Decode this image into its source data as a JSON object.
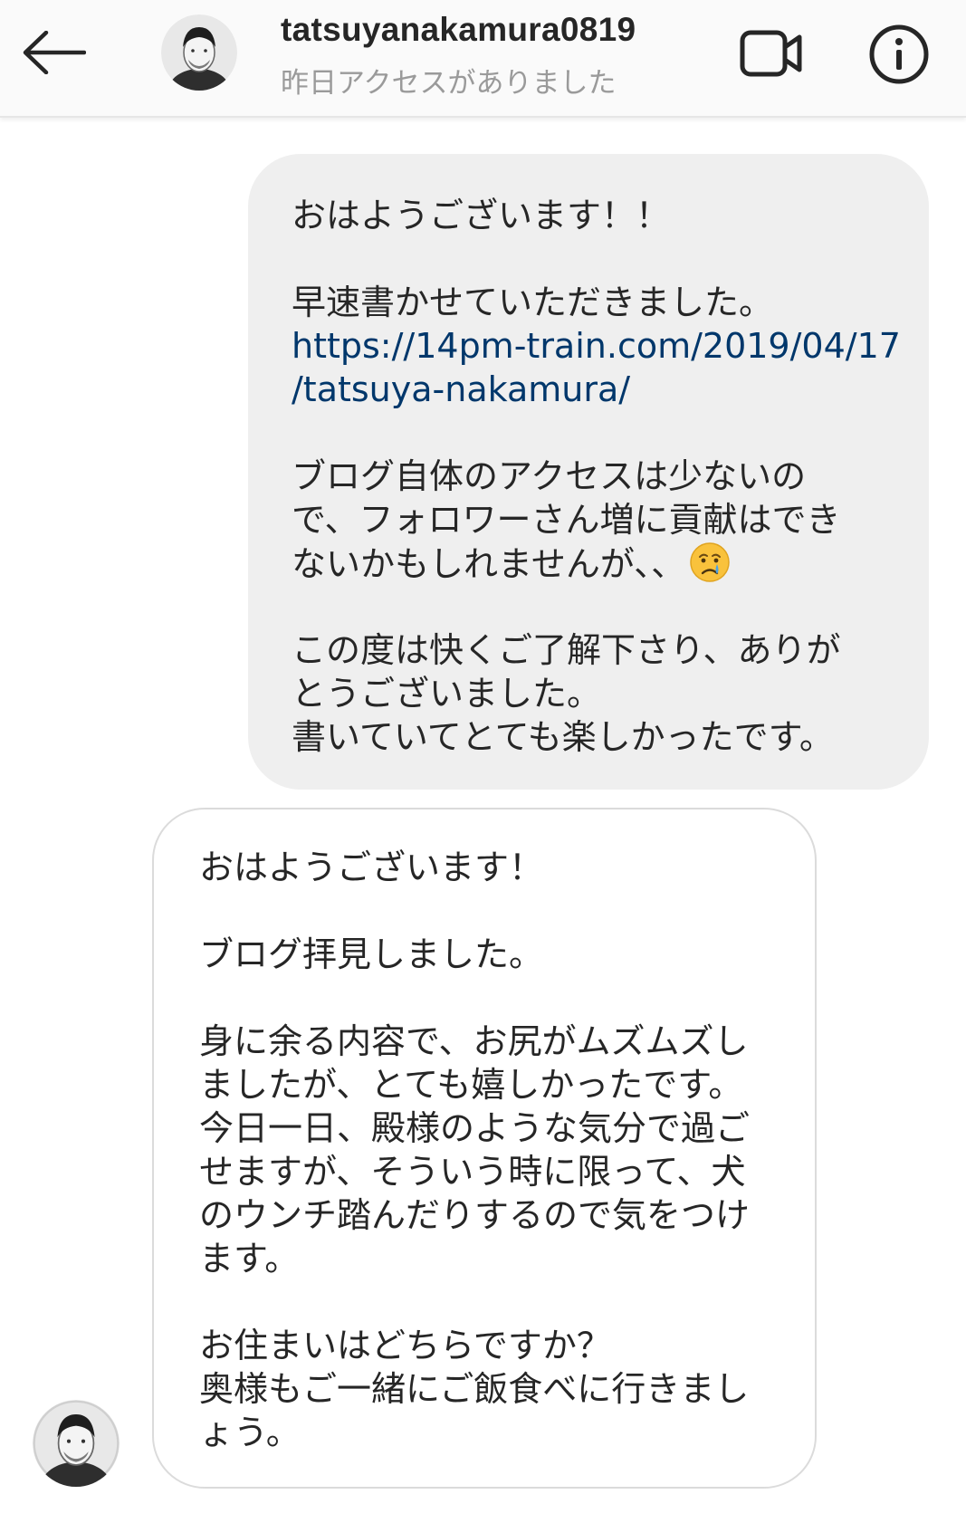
{
  "header": {
    "username": "tatsuyanakamura0819",
    "status": "昨日アクセスがありました",
    "back_icon": "arrow-left-icon",
    "video_icon": "video-camera-icon",
    "info_icon": "info-circle-icon"
  },
  "messages": {
    "outgoing": {
      "greeting": "おはようございます！！",
      "line2": "早速書かせていただきました。",
      "link_line1": "https://14pm-train.com/2019/04/17",
      "link_line2": "/tatsuya-nakamura/",
      "para3_line1": "ブログ自体のアクセスは少ないの",
      "para3_line2": "で、フォロワーさん増に貢献はでき",
      "para3_line3": "ないかもしれませんが、、",
      "para3_emoji": "crying-face-emoji",
      "para4_line1": "この度は快くご了解下さり、ありが",
      "para4_line2": "とうございました。",
      "para4_line3": "書いていてとても楽しかったです。"
    },
    "incoming": {
      "greeting": "おはようございます！",
      "line2": "ブログ拝見しました。",
      "para3_line1": "身に余る内容で、お尻がムズムズし",
      "para3_line2": "ましたが、とても嬉しかったです。",
      "para3_line3": "今日一日、殿様のような気分で過ご",
      "para3_line4": "せますが、そういう時に限って、犬",
      "para3_line5": "のウンチ踏んだりするので気をつけ",
      "para3_line6": "ます。",
      "para4_line1": "お住まいはどちらですか？",
      "para4_line2": "奥様もご一緒にご飯食べに行きまし",
      "para4_line3": "ょう。"
    }
  },
  "colors": {
    "header_bg": "#fafafa",
    "outgoing_bubble": "#efefef",
    "incoming_border": "#dbdbdb",
    "link": "#00376b",
    "status_text": "#9a9a9a"
  }
}
